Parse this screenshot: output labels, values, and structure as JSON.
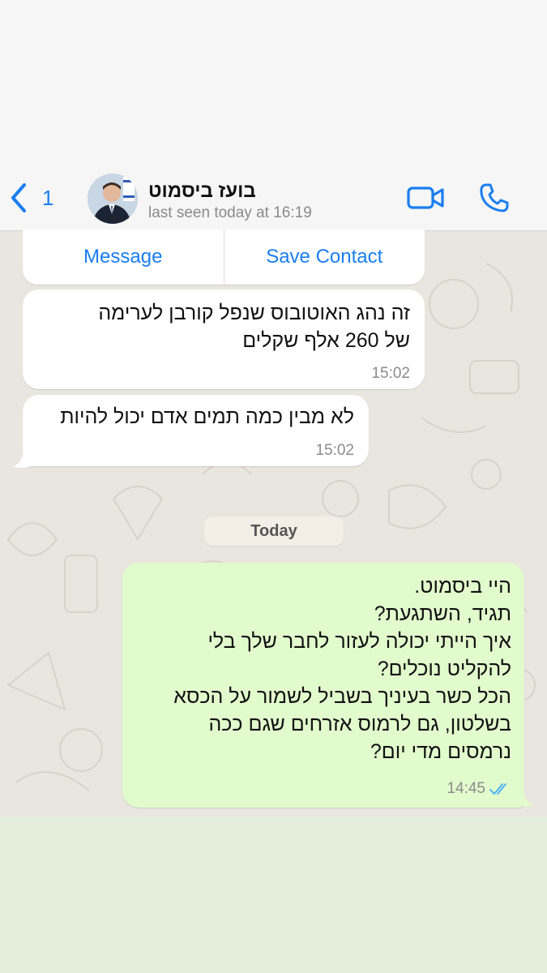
{
  "header": {
    "back_count": "1",
    "contact_name": "בועז ביסמוט",
    "last_seen": "last seen today at 16:19"
  },
  "icons": {
    "back": "chevron-left-icon",
    "video": "video-camera-icon",
    "call": "phone-icon",
    "read_receipt": "double-check-icon"
  },
  "contact_card": {
    "message_label": "Message",
    "save_label": "Save Contact"
  },
  "messages": [
    {
      "direction": "incoming",
      "text": "זה נהג האוטובוס שנפל קורבן לערימה\nשל 260 אלף שקלים",
      "time": "15:02"
    },
    {
      "direction": "incoming",
      "text": "לא מבין כמה תמים אדם יכול להיות",
      "time": "15:02"
    },
    {
      "direction": "outgoing",
      "text": "היי ביסמוט.\nתגיד, השתגעת?\nאיך הייתי יכולה לעזור לחבר שלך בלי\nלהקליט נוכלים?\nהכל כשר בעיניך בשביל לשמור על הכסא\nבשלטון, גם לרמוס אזרחים שגם ככה\nנרמסים מדי יום?",
      "time": "14:45",
      "status": "read"
    }
  ],
  "date_separator": "Today",
  "colors": {
    "accent": "#1a7ef0",
    "incoming_bubble": "#ffffff",
    "outgoing_bubble": "#e2fbcd",
    "chat_background": "#e9e6df",
    "read_ticks": "#4fb3f7"
  }
}
